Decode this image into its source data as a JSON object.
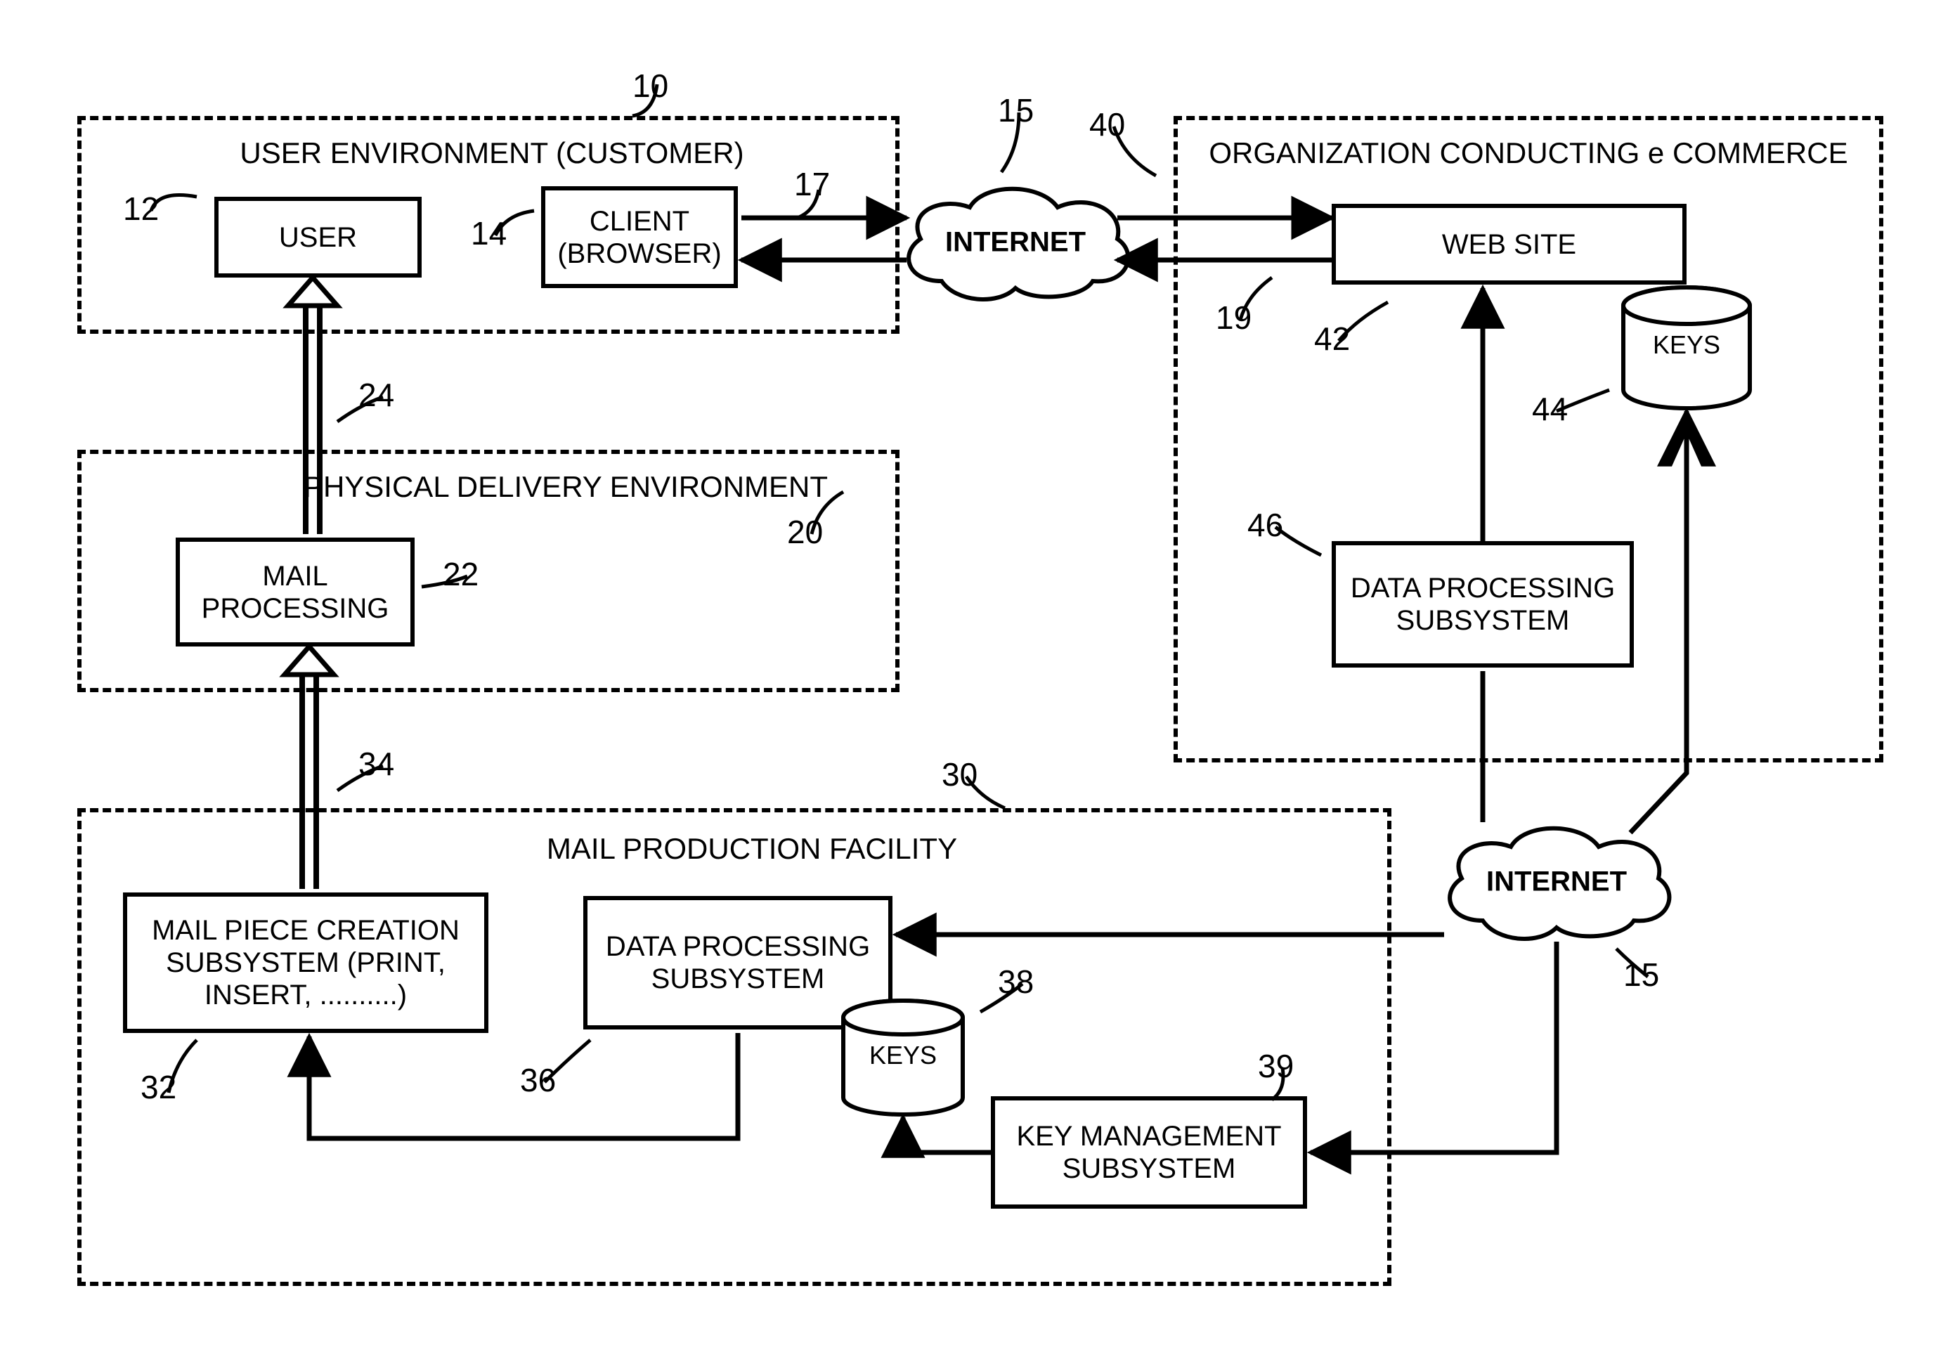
{
  "regions": {
    "user_env": {
      "title": "USER ENVIRONMENT (CUSTOMER)",
      "ref": "10"
    },
    "phys_env": {
      "title": "PHYSICAL DELIVERY ENVIRONMENT",
      "ref": "20"
    },
    "mail_fac": {
      "title": "MAIL PRODUCTION FACILITY",
      "ref": "30"
    },
    "org_ecom": {
      "title": "ORGANIZATION CONDUCTING e COMMERCE",
      "ref": "40"
    }
  },
  "boxes": {
    "user": {
      "label": "USER",
      "ref": "12"
    },
    "client": {
      "label": "CLIENT\n(BROWSER)",
      "ref": "14"
    },
    "mail_proc": {
      "label": "MAIL\nPROCESSING",
      "ref": "22"
    },
    "mail_piece": {
      "label": "MAIL PIECE CREATION\nSUBSYSTEM (PRINT,\nINSERT, ..........)",
      "ref": "32"
    },
    "dp_fac": {
      "label": "DATA PROCESSING\nSUBSYSTEM",
      "ref": "36"
    },
    "key_mgmt": {
      "label": "KEY MANAGEMENT\nSUBSYSTEM",
      "ref": "39"
    },
    "website": {
      "label": "WEB SITE",
      "ref": "42"
    },
    "dp_org": {
      "label": "DATA PROCESSING\nSUBSYSTEM",
      "ref": "46"
    }
  },
  "clouds": {
    "internet1": {
      "label": "INTERNET",
      "ref": "15"
    },
    "internet2": {
      "label": "INTERNET",
      "ref": "15"
    }
  },
  "dbs": {
    "keys_fac": {
      "label": "KEYS",
      "ref": "38"
    },
    "keys_org": {
      "label": "KEYS",
      "ref": "44"
    }
  },
  "arrows": {
    "a17": {
      "ref": "17"
    },
    "a19": {
      "ref": "19"
    },
    "a24": {
      "ref": "24"
    },
    "a34": {
      "ref": "34"
    }
  }
}
